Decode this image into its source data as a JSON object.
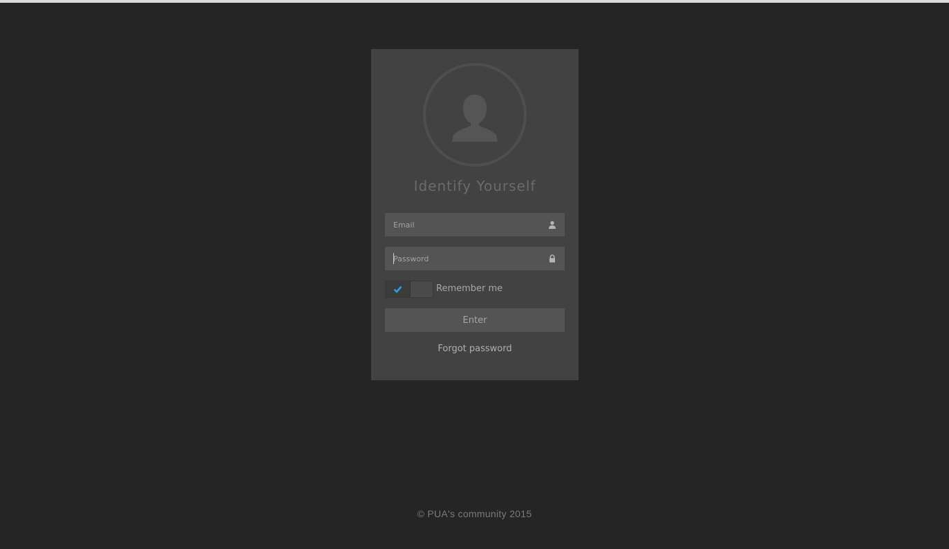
{
  "login": {
    "title": "Identify Yourself",
    "email": {
      "placeholder": "Email",
      "value": "",
      "icon": "user-icon"
    },
    "password": {
      "placeholder": "Password",
      "value": "",
      "icon": "lock-icon"
    },
    "remember": {
      "label": "Remember me",
      "checked": true,
      "icon": "check-icon"
    },
    "enter_label": "Enter",
    "forgot_label": "Forgot password",
    "avatar_icon": "user-silhouette-icon"
  },
  "footer": {
    "text": "© PUA's community 2015"
  },
  "colors": {
    "background": "#252525",
    "card": "#424242",
    "field": "#545454",
    "accent": "#2aa3d6"
  }
}
